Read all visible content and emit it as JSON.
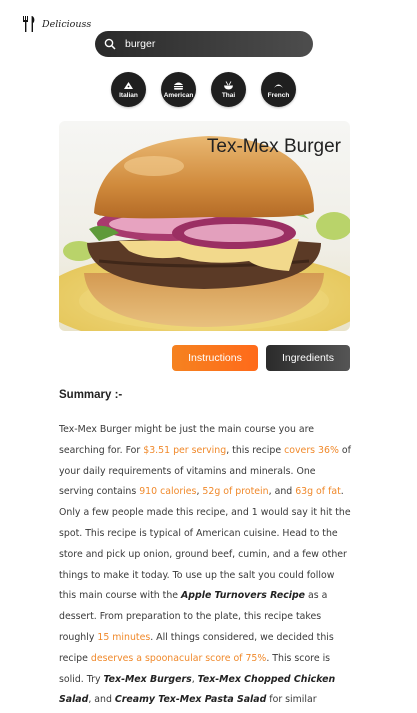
{
  "header": {
    "logo_text": "Deliciouss",
    "logo_icon": "fork-knife-icon"
  },
  "search": {
    "value": "burger",
    "icon": "search-icon"
  },
  "cuisines": [
    {
      "label": "Italian",
      "icon": "pizza-icon"
    },
    {
      "label": "American",
      "icon": "burger-icon"
    },
    {
      "label": "Thai",
      "icon": "bowl-icon"
    },
    {
      "label": "French",
      "icon": "croissant-icon"
    }
  ],
  "recipe": {
    "title": "Tex-Mex Burger",
    "image_alt": "burger-photo"
  },
  "tabs": {
    "instructions": "Instructions",
    "ingredients": "Ingredients"
  },
  "summary_heading": "Summary :-",
  "summary": {
    "s01": "Tex-Mex Burger might be just the main course you are searching for. For ",
    "s02": "$3.51 per serving",
    "s03": ", this recipe ",
    "s04": "covers 36%",
    "s05": " of your daily requirements of vitamins and minerals. One serving contains ",
    "s06": "910 calories",
    "s07": ", ",
    "s08": "52g of protein",
    "s09": ", and ",
    "s10": "63g of fat",
    "s11": ". Only a few people made this recipe, and 1 would say it hit the spot. This recipe is typical of American cuisine. Head to the store and pick up onion, ground beef, cumin, and a few other things to make it today. To use up the salt you could follow this main course with the ",
    "s12": "Apple Turnovers Recipe",
    "s13": " as a dessert. From preparation to the plate, this recipe takes roughly ",
    "s14": "15 minutes",
    "s15": ". All things considered, we decided this recipe ",
    "s16": "deserves a spoonacular score of 75%",
    "s17": ". This score is solid. Try ",
    "s18": "Tex-Mex Burgers",
    "s19": ", ",
    "s20": "Tex-Mex Chopped Chicken Salad",
    "s21": ", and ",
    "s22": "Creamy Tex-Mex Pasta Salad",
    "s23": " for similar recipes."
  },
  "colors": {
    "accent": "#f58220",
    "dark": "#2b2b2b"
  }
}
